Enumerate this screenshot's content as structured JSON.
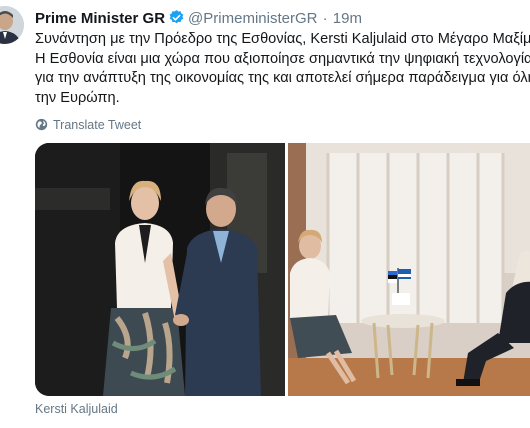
{
  "tweet": {
    "author_name": "Prime Minister GR",
    "handle": "@PrimeministerGR",
    "separator": "·",
    "time": "19m",
    "text_lines": [
      "Συνάντηση με την Πρόεδρο της Εσθονίας, Kersti Kaljulaid στο Μέγαρο Μαξίμου.",
      "Η Εσθονία είναι μια χώρα που αξιοποίησε σημαντικά την ψηφιακή τεχνολογία",
      "για την ανάπτυξη της οικονομίας της και αποτελεί σήμερα παράδειγμα για όλη",
      "την Ευρώπη."
    ],
    "translate_label": "Translate Tweet",
    "media_caption": "Kersti Kaljulaid"
  },
  "colors": {
    "verified_badge": "#1da1f2",
    "secondary_text": "#657786",
    "primary_text": "#14171a"
  },
  "icons": {
    "verified": "verified-badge-icon",
    "translate": "globe-icon"
  }
}
